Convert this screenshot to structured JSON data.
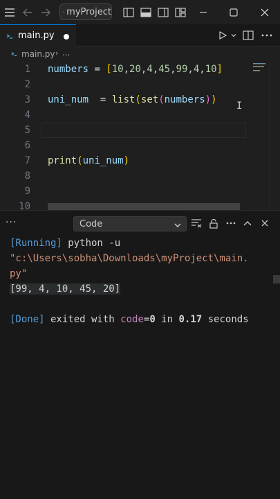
{
  "titlebar": {
    "search_text": "myProject"
  },
  "tab": {
    "name": "main.py"
  },
  "breadcrumb": {
    "file": "main.py",
    "more": "..."
  },
  "editor": {
    "lines": [
      {
        "n": "1",
        "parts": [
          [
            "var",
            "numbers"
          ],
          [
            "plain",
            " = "
          ],
          [
            "br1",
            "["
          ],
          [
            "num",
            "10"
          ],
          [
            "plain",
            ","
          ],
          [
            "num",
            "20"
          ],
          [
            "plain",
            ","
          ],
          [
            "num",
            "4"
          ],
          [
            "plain",
            ","
          ],
          [
            "num",
            "45"
          ],
          [
            "plain",
            ","
          ],
          [
            "num",
            "99"
          ],
          [
            "plain",
            ","
          ],
          [
            "num",
            "4"
          ],
          [
            "plain",
            ","
          ],
          [
            "num",
            "10"
          ],
          [
            "br1",
            "]"
          ]
        ]
      },
      {
        "n": "2",
        "parts": []
      },
      {
        "n": "3",
        "parts": [
          [
            "var",
            "uni_num"
          ],
          [
            "plain",
            "  = "
          ],
          [
            "fn",
            "list"
          ],
          [
            "br1",
            "("
          ],
          [
            "fn",
            "set"
          ],
          [
            "br2",
            "("
          ],
          [
            "var",
            "numbers"
          ],
          [
            "br2",
            ")"
          ],
          [
            "br1",
            ")"
          ]
        ]
      },
      {
        "n": "4",
        "parts": []
      },
      {
        "n": "5",
        "parts": []
      },
      {
        "n": "6",
        "parts": []
      },
      {
        "n": "7",
        "parts": [
          [
            "fn",
            "print"
          ],
          [
            "br1",
            "("
          ],
          [
            "var",
            "uni_num"
          ],
          [
            "br1",
            ")"
          ]
        ]
      },
      {
        "n": "8",
        "parts": []
      },
      {
        "n": "9",
        "parts": []
      },
      {
        "n": "10",
        "parts": []
      }
    ]
  },
  "panel": {
    "dots": "···",
    "dropdown_label": "Code",
    "output": [
      [
        [
          "tag",
          "[Running]"
        ],
        [
          "plain",
          " python -u"
        ]
      ],
      [
        [
          "str",
          "\"c:\\Users\\sobha\\Downloads\\myProject\\main."
        ]
      ],
      [
        [
          "str",
          "py\""
        ]
      ],
      [
        [
          "result",
          "[99, 4, 10, 45, 20]"
        ]
      ],
      [],
      [
        [
          "tag",
          "[Done]"
        ],
        [
          "plain",
          " exited with "
        ],
        [
          "done-word",
          "code"
        ],
        [
          "plain",
          "="
        ],
        [
          "bold-num",
          "0"
        ],
        [
          "plain",
          " in "
        ],
        [
          "bold-num",
          "0.17"
        ],
        [
          "plain",
          " seconds"
        ]
      ]
    ]
  },
  "colors": {
    "accent": "#0078d4",
    "background": "#1f1f1f",
    "panel_background": "#181818"
  }
}
